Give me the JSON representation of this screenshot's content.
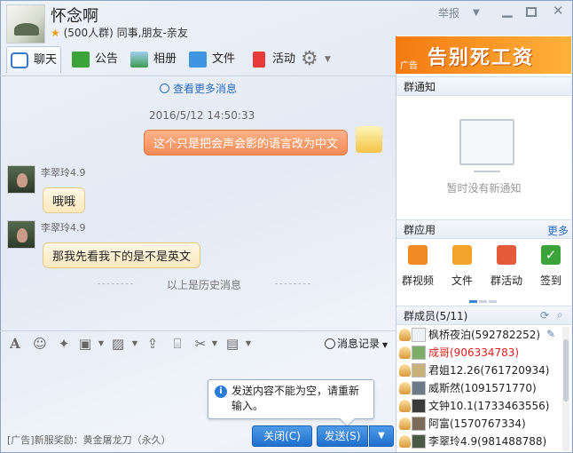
{
  "header": {
    "group_name": "怀念啊",
    "group_info": "(500人群) 同事,朋友-亲友",
    "report": "举报",
    "min_icon": "minimize-icon",
    "max_icon": "maximize-icon",
    "close_icon": "close-icon"
  },
  "tabs": [
    {
      "label": "聊天",
      "icon": "chat-icon"
    },
    {
      "label": "公告",
      "icon": "announcement-icon"
    },
    {
      "label": "相册",
      "icon": "album-icon"
    },
    {
      "label": "文件",
      "icon": "folder-icon"
    },
    {
      "label": "活动",
      "icon": "flag-icon"
    }
  ],
  "chat": {
    "view_more": "查看更多消息",
    "timestamp": "2016/5/12 14:50:33",
    "my_message": "这个只是把会声会影的语言改为中文",
    "messages": [
      {
        "user": "李翠玲4.9",
        "text": "哦哦"
      },
      {
        "user": "李翠玲4.9",
        "text": "那我先看我下的是不是英文"
      }
    ],
    "history_divider": "以上是历史消息"
  },
  "input": {
    "record_label": "消息记录",
    "ad_text": "[广告]新服奖励：黄金屠龙刀（永久）",
    "close_btn": "关闭(C)",
    "send_btn": "发送(S)",
    "tooltip": "发送内容不能为空，请重新输入。"
  },
  "right": {
    "banner_ad": "广告",
    "banner_text": "告别死工资",
    "notice_title": "群通知",
    "no_notice": "暂时没有新通知",
    "apps_title": "群应用",
    "apps_more": "更多",
    "apps": [
      {
        "label": "群视频",
        "color": "#f08a24"
      },
      {
        "label": "文件",
        "color": "#f2a42a"
      },
      {
        "label": "群活动",
        "color": "#e45b3a"
      },
      {
        "label": "签到",
        "color": "#3aa33a"
      }
    ],
    "members_title": "群成员(5/11)",
    "members": [
      {
        "name": "枫桥夜泊(592782252)",
        "color": "#222"
      },
      {
        "name": "成哥(906334783)",
        "color": "#e02020"
      },
      {
        "name": "君姐12.26(761720934)",
        "color": "#222"
      },
      {
        "name": "威斯然(1091571770)",
        "color": "#222"
      },
      {
        "name": "文钟10.1(1733463556)",
        "color": "#222"
      },
      {
        "name": "阿富(1570767334)",
        "color": "#222"
      },
      {
        "name": "李翠玲4.9(981488788)",
        "color": "#222"
      }
    ]
  }
}
